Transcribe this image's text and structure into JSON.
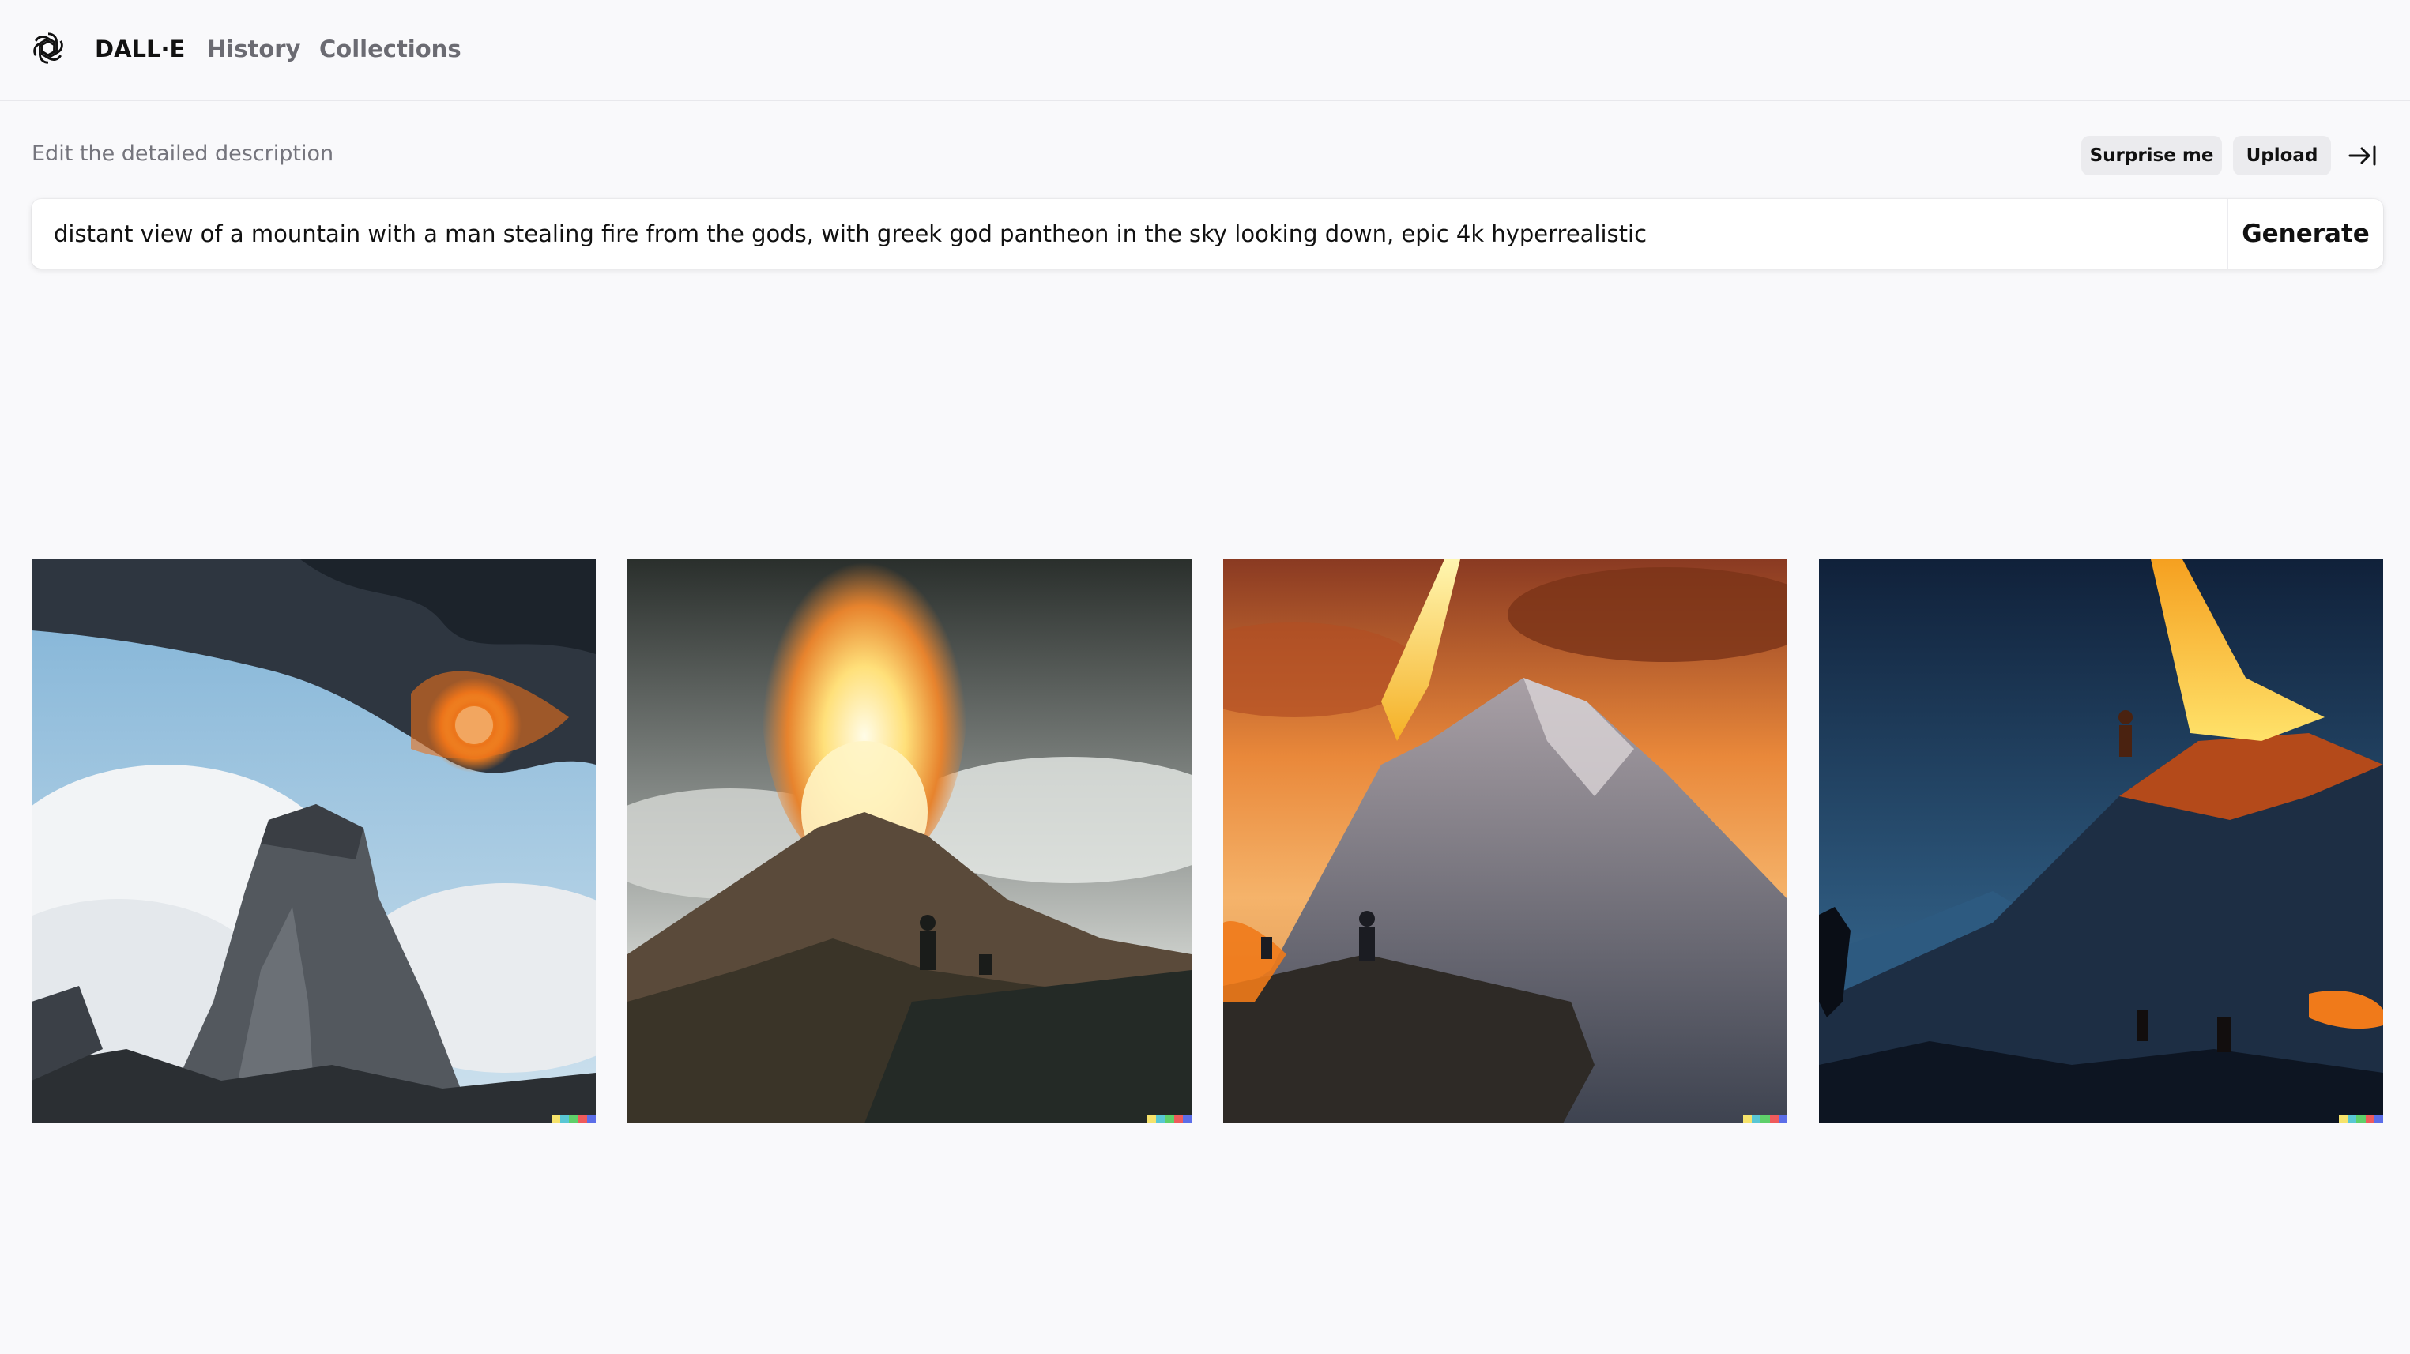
{
  "nav": {
    "brand": "DALL·E",
    "history": "History",
    "collections": "Collections",
    "logo_icon": "openai-logo-icon"
  },
  "editor": {
    "label": "Edit the detailed description",
    "surprise_label": "Surprise me",
    "upload_label": "Upload",
    "collapse_icon": "collapse-right-arrow-icon",
    "prompt_value": "distant view of a mountain with a man stealing fire from the gods, with greek god pantheon in the sky looking down, epic 4k hyperrealistic",
    "generate_label": "Generate"
  },
  "results": [
    {
      "description": "volcano with fire ring under cloudy blue sky"
    },
    {
      "description": "erupting mountain with figures on ridge"
    },
    {
      "description": "orange sunset mountain with lone figure"
    },
    {
      "description": "night mountain with lava glow and rider"
    }
  ],
  "colors": {
    "background": "#f9f9fb",
    "signature": [
      "#f6e36b",
      "#59c7d4",
      "#5fd06a",
      "#ef5b5b",
      "#5c6ee8"
    ]
  }
}
